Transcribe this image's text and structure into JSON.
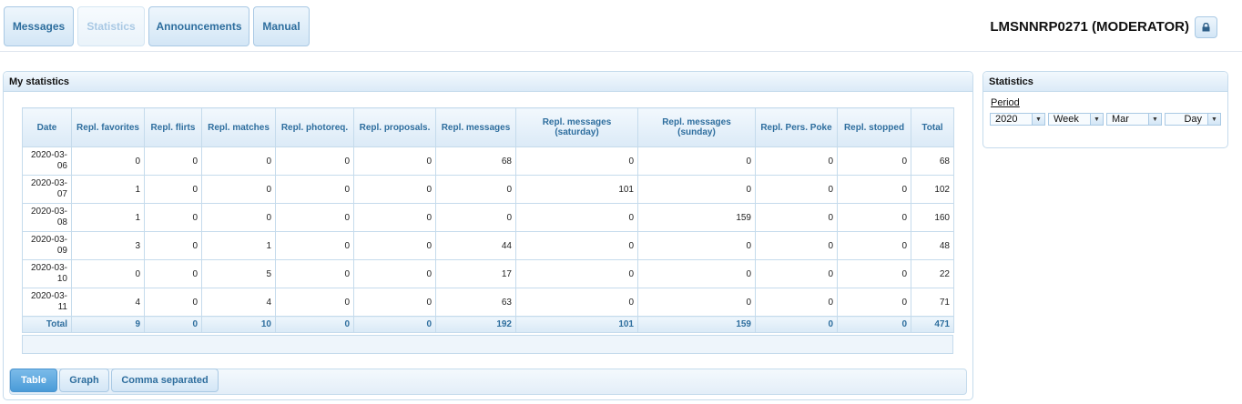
{
  "nav": {
    "tabs": [
      "Messages",
      "Statistics",
      "Announcements",
      "Manual"
    ],
    "user": "LMSNNRP0271 (MODERATOR)"
  },
  "main_panel": {
    "title": "My statistics"
  },
  "table": {
    "headers": [
      "Date",
      "Repl. favorites",
      "Repl. flirts",
      "Repl. matches",
      "Repl. photoreq.",
      "Repl. proposals.",
      "Repl. messages",
      "Repl. messages (saturday)",
      "Repl. messages (sunday)",
      "Repl. Pers. Poke",
      "Repl. stopped",
      "Total"
    ],
    "rows": [
      [
        "2020-03-06",
        "0",
        "0",
        "0",
        "0",
        "0",
        "68",
        "0",
        "0",
        "0",
        "0",
        "68"
      ],
      [
        "2020-03-07",
        "1",
        "0",
        "0",
        "0",
        "0",
        "0",
        "101",
        "0",
        "0",
        "0",
        "102"
      ],
      [
        "2020-03-08",
        "1",
        "0",
        "0",
        "0",
        "0",
        "0",
        "0",
        "159",
        "0",
        "0",
        "160"
      ],
      [
        "2020-03-09",
        "3",
        "0",
        "1",
        "0",
        "0",
        "44",
        "0",
        "0",
        "0",
        "0",
        "48"
      ],
      [
        "2020-03-10",
        "0",
        "0",
        "5",
        "0",
        "0",
        "17",
        "0",
        "0",
        "0",
        "0",
        "22"
      ],
      [
        "2020-03-11",
        "4",
        "0",
        "4",
        "0",
        "0",
        "63",
        "0",
        "0",
        "0",
        "0",
        "71"
      ]
    ],
    "total": [
      "Total",
      "9",
      "0",
      "10",
      "0",
      "0",
      "192",
      "101",
      "159",
      "0",
      "0",
      "471"
    ]
  },
  "view_tabs": [
    "Table",
    "Graph",
    "Comma separated"
  ],
  "side_panel": {
    "title": "Statistics",
    "period_label": "Period",
    "selects": [
      "2020",
      "Week",
      "Mar",
      "Day"
    ]
  },
  "colors": {
    "accent": "#2e6e9e",
    "border": "#c5dbec",
    "active_tab": "#4a9bd8"
  },
  "icons": [
    "lock-icon",
    "dropdown-arrow-icon"
  ]
}
